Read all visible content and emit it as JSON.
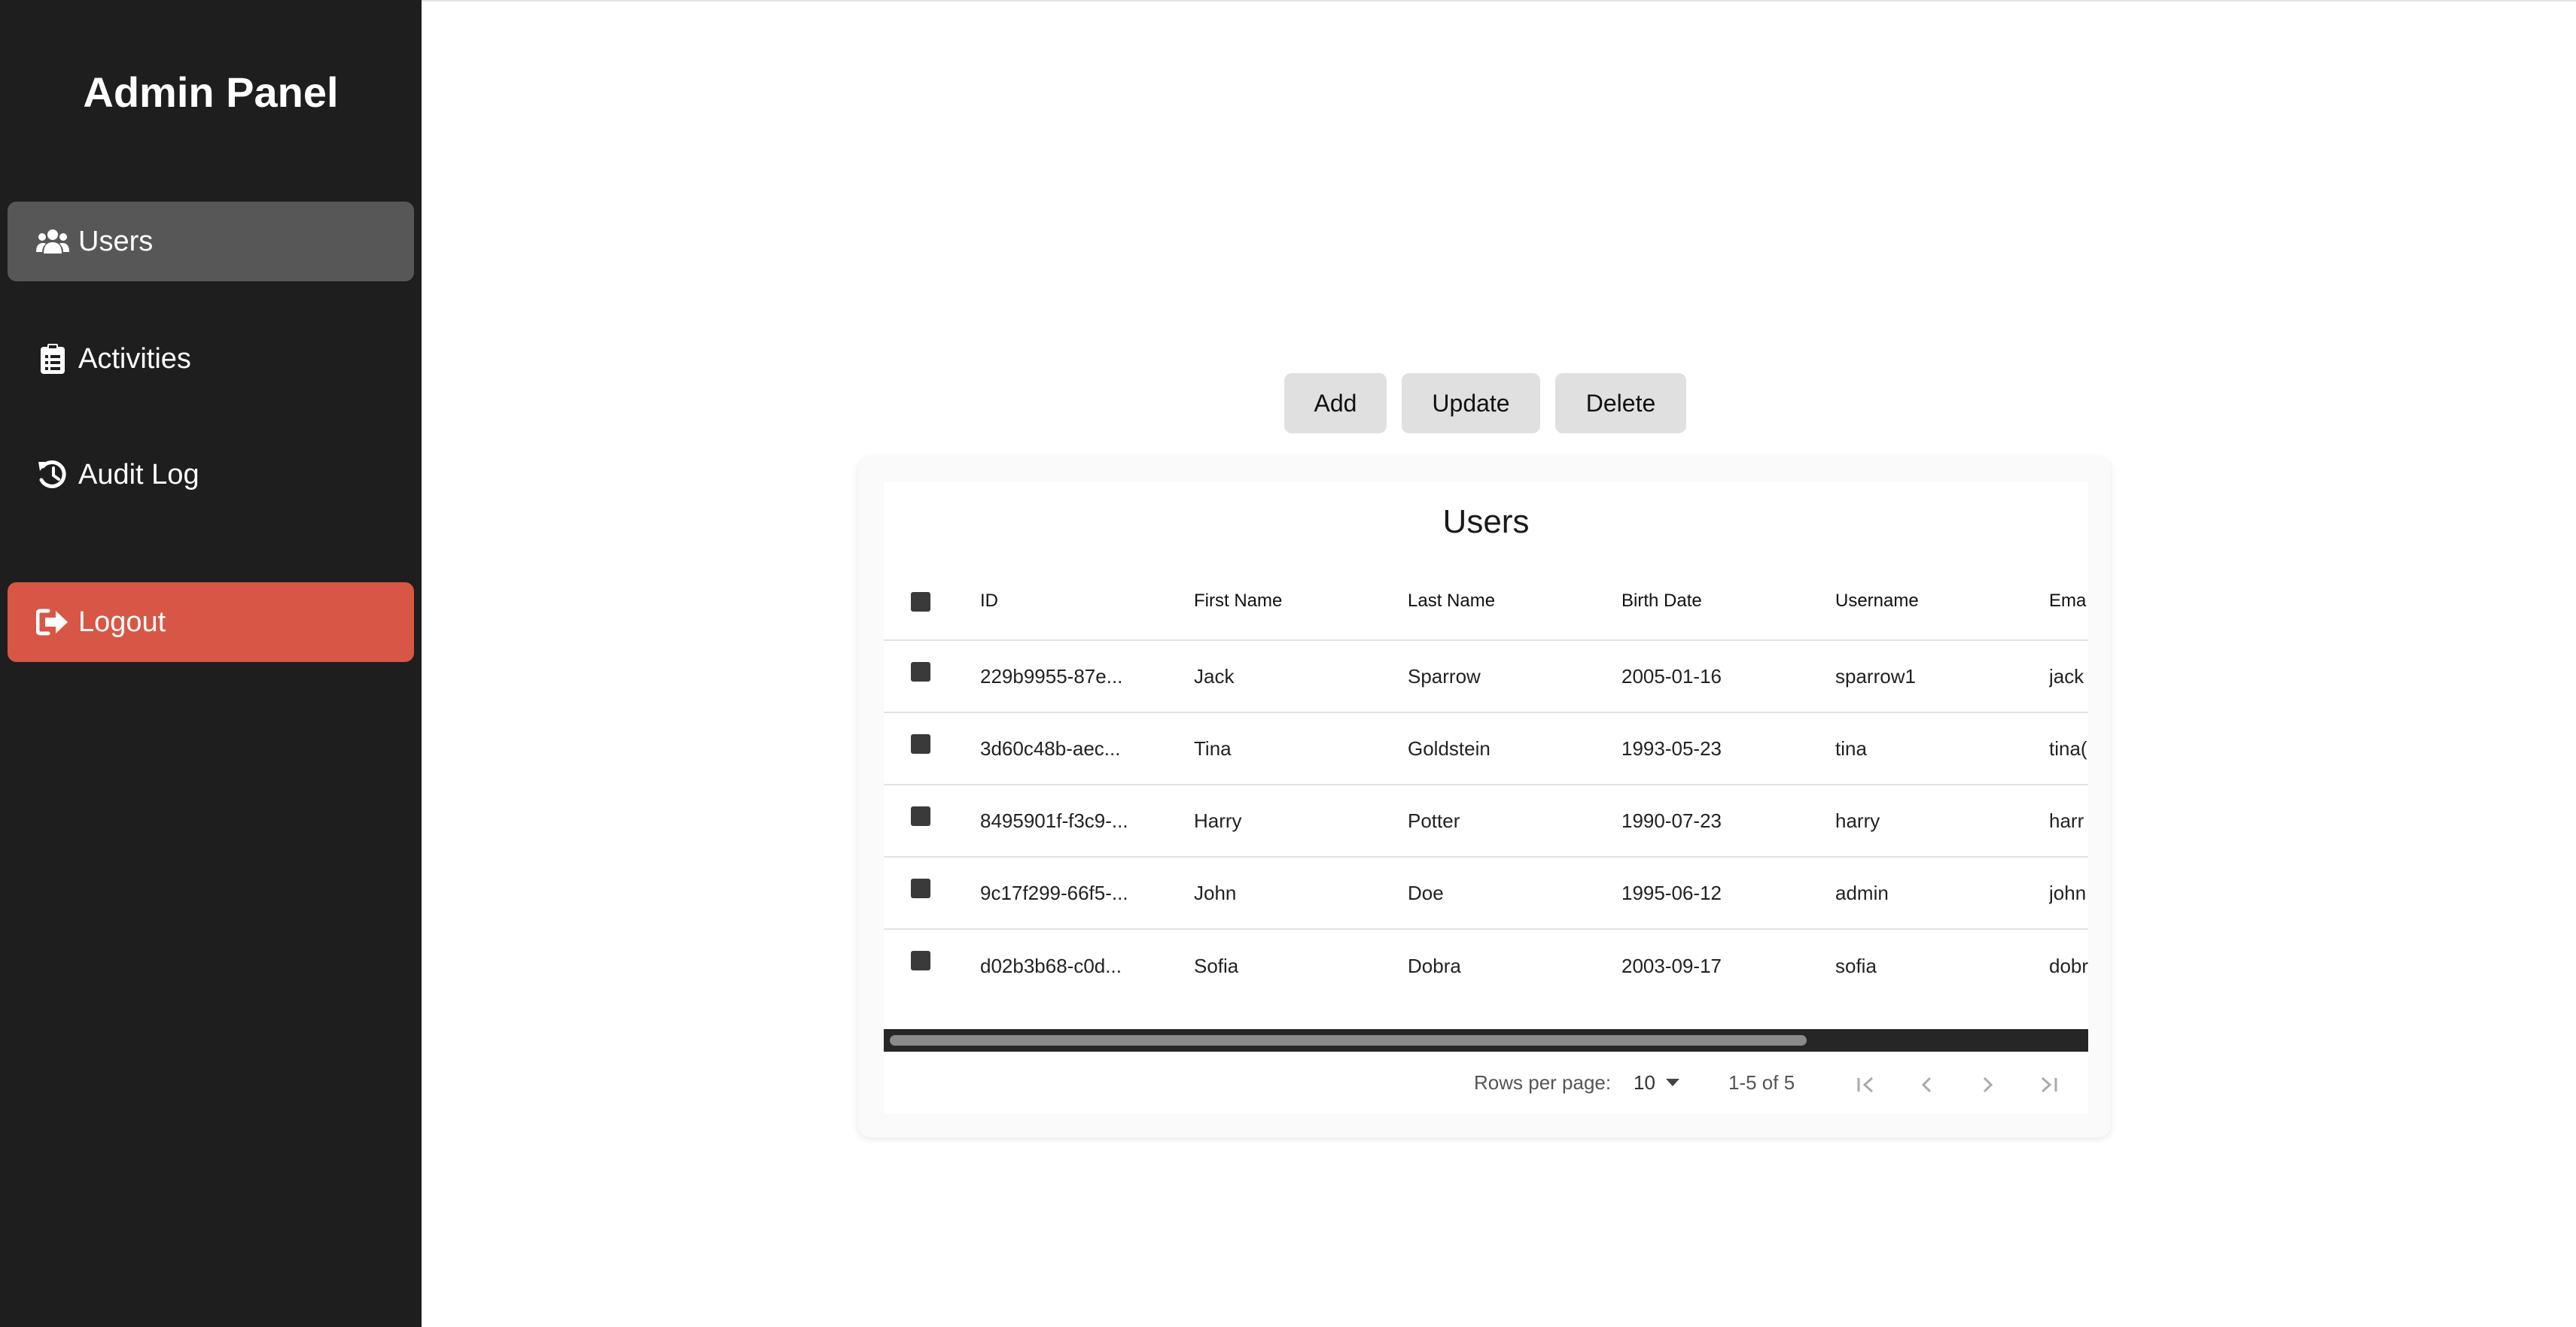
{
  "sidebar": {
    "brand": "Admin Panel",
    "items": [
      {
        "label": "Users",
        "icon": "users-icon",
        "active": true
      },
      {
        "label": "Activities",
        "icon": "clipboard-icon",
        "active": false
      },
      {
        "label": "Audit Log",
        "icon": "history-icon",
        "active": false
      }
    ],
    "logout": {
      "label": "Logout",
      "icon": "logout-icon",
      "color": "#d85645"
    }
  },
  "toolbar": {
    "add_label": "Add",
    "update_label": "Update",
    "delete_label": "Delete"
  },
  "table": {
    "title": "Users",
    "columns": [
      "ID",
      "First Name",
      "Last Name",
      "Birth Date",
      "Username",
      "Ema"
    ],
    "rows": [
      [
        "229b9955-87e...",
        "Jack",
        "Sparrow",
        "2005-01-16",
        "sparrow1",
        "jack"
      ],
      [
        "3d60c48b-aec...",
        "Tina",
        "Goldstein",
        "1993-05-23",
        "tina",
        "tina("
      ],
      [
        "8495901f-f3c9-...",
        "Harry",
        "Potter",
        "1990-07-23",
        "harry",
        "harr"
      ],
      [
        "9c17f299-66f5-...",
        "John",
        "Doe",
        "1995-06-12",
        "admin",
        "john"
      ],
      [
        "d02b3b68-c0d...",
        "Sofia",
        "Dobra",
        "2003-09-17",
        "sofia",
        "dobr"
      ]
    ],
    "pagination": {
      "rows_per_page_label": "Rows per page:",
      "rows_per_page_value": "10",
      "range": "1-5 of 5"
    }
  },
  "colors": {
    "sidebar_bg": "#1e1e1e",
    "active_item_bg": "#575757",
    "logout_bg": "#d85645"
  }
}
